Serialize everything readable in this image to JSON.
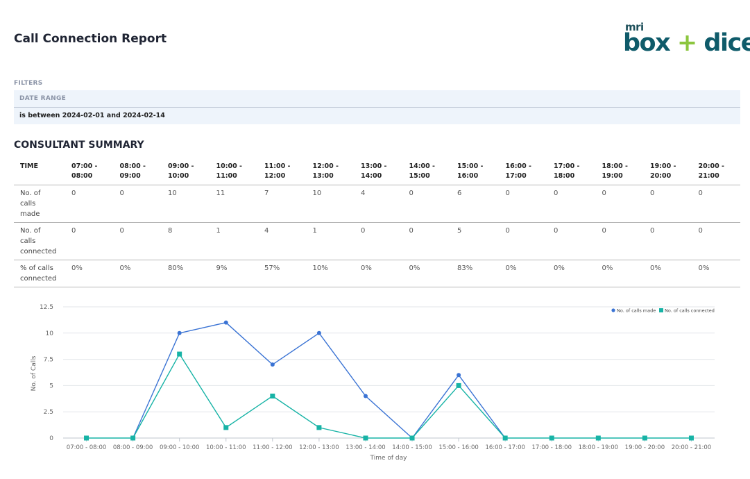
{
  "report": {
    "title": "Call Connection Report"
  },
  "logo": {
    "mri": "mri",
    "word_left": "box",
    "plus": "+",
    "word_right": "dice"
  },
  "filters": {
    "label": "FILTERS",
    "date_range_label": "DATE RANGE",
    "date_range_value": "is between 2024-02-01 and 2024-02-14"
  },
  "summary": {
    "title": "CONSULTANT SUMMARY",
    "time_header": "TIME",
    "slots": [
      [
        "07:00 -",
        "08:00"
      ],
      [
        "08:00 -",
        "09:00"
      ],
      [
        "09:00 -",
        "10:00"
      ],
      [
        "10:00 -",
        "11:00"
      ],
      [
        "11:00 -",
        "12:00"
      ],
      [
        "12:00 -",
        "13:00"
      ],
      [
        "13:00 -",
        "14:00"
      ],
      [
        "14:00 -",
        "15:00"
      ],
      [
        "15:00 -",
        "16:00"
      ],
      [
        "16:00 -",
        "17:00"
      ],
      [
        "17:00 -",
        "18:00"
      ],
      [
        "18:00 -",
        "19:00"
      ],
      [
        "19:00 -",
        "20:00"
      ],
      [
        "20:00 -",
        "21:00"
      ]
    ],
    "rows": [
      {
        "label": [
          "No. of",
          "calls",
          "made"
        ],
        "values": [
          "0",
          "0",
          "10",
          "11",
          "7",
          "10",
          "4",
          "0",
          "6",
          "0",
          "0",
          "0",
          "0",
          "0"
        ]
      },
      {
        "label": [
          "No. of",
          "calls",
          "connected"
        ],
        "values": [
          "0",
          "0",
          "8",
          "1",
          "4",
          "1",
          "0",
          "0",
          "5",
          "0",
          "0",
          "0",
          "0",
          "0"
        ]
      },
      {
        "label": [
          "% of calls",
          "connected"
        ],
        "values": [
          "0%",
          "0%",
          "80%",
          "9%",
          "57%",
          "10%",
          "0%",
          "0%",
          "83%",
          "0%",
          "0%",
          "0%",
          "0%",
          "0%"
        ]
      }
    ]
  },
  "chart_data": {
    "type": "line",
    "categories": [
      "07:00 - 08:00",
      "08:00 - 09:00",
      "09:00 - 10:00",
      "10:00 - 11:00",
      "11:00 - 12:00",
      "12:00 - 13:00",
      "13:00 - 14:00",
      "14:00 - 15:00",
      "15:00 - 16:00",
      "16:00 - 17:00",
      "17:00 - 18:00",
      "18:00 - 19:00",
      "19:00 - 20:00",
      "20:00 - 21:00"
    ],
    "series": [
      {
        "name": "No. of calls made",
        "color": "#3a73d4",
        "marker": "circle",
        "values": [
          null,
          0,
          10,
          11,
          7,
          10,
          4,
          0,
          6,
          0,
          null,
          null,
          null,
          null
        ]
      },
      {
        "name": "No. of calls connected",
        "color": "#17b3a6",
        "marker": "square",
        "values": [
          0,
          0,
          8,
          1,
          4,
          1,
          0,
          0,
          5,
          0,
          0,
          0,
          0,
          0
        ]
      }
    ],
    "xlabel": "Time of day",
    "ylabel": "No. of Calls",
    "ylim": [
      0,
      12.5
    ],
    "yticks": [
      "0",
      "2.5",
      "5",
      "7.5",
      "10",
      "12.5"
    ],
    "ytick_values": [
      0,
      2.5,
      5,
      7.5,
      10,
      12.5
    ],
    "grid": true,
    "legend_position": "top-right"
  }
}
